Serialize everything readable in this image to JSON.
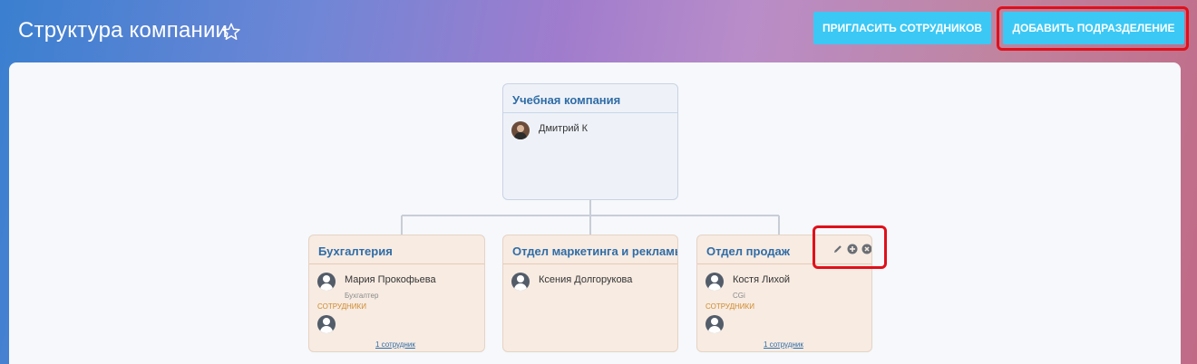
{
  "header": {
    "title": "Структура компании",
    "invite_button": "ПРИГЛАСИТЬ СОТРУДНИКОВ",
    "add_button": "ДОБАВИТЬ ПОДРАЗДЕЛЕНИЕ"
  },
  "root": {
    "title": "Учебная компания",
    "head_name": "Дмитрий К"
  },
  "departments": [
    {
      "title": "Бухгалтерия",
      "head_name": "Мария Прокофьева",
      "head_role": "Бухгалтер",
      "staff_label": "СОТРУДНИКИ",
      "staff_count": "1 сотрудник"
    },
    {
      "title": "Отдел маркетинга и рекламы",
      "head_name": "Ксения Долгорукова"
    },
    {
      "title": "Отдел продаж",
      "head_name": "Костя Лихой",
      "head_role": "CGi",
      "staff_label": "СОТРУДНИКИ",
      "staff_count": "1 сотрудник"
    }
  ],
  "icons": {
    "favorite": "star-icon",
    "edit": "pencil-icon",
    "add": "plus-circle-icon",
    "delete": "close-circle-icon",
    "user": "user-avatar-icon"
  },
  "colors": {
    "accent_button": "#3bc8f5",
    "title_link": "#2f6ca6",
    "highlight": "#e0101b",
    "staff_label": "#d08a2b",
    "dept_card_bg": "#f7ebe2",
    "root_card_bg": "#eef2f8"
  }
}
